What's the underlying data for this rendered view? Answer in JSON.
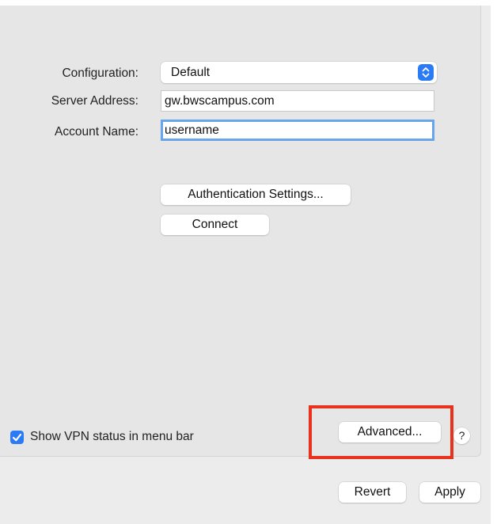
{
  "form": {
    "configuration_label": "Configuration:",
    "configuration_value": "Default",
    "server_address_label": "Server Address:",
    "server_address_value": "gw.bwscampus.com",
    "account_name_label": "Account Name:",
    "account_name_value": "username"
  },
  "buttons": {
    "authentication_settings": "Authentication Settings...",
    "connect": "Connect",
    "advanced": "Advanced...",
    "help": "?",
    "revert": "Revert",
    "apply": "Apply"
  },
  "options": {
    "show_vpn_status_label": "Show VPN status in menu bar",
    "show_vpn_status_checked": true
  },
  "colors": {
    "accent": "#2c7bf6",
    "focus_ring": "#6aa5ec",
    "highlight_box": "#e8321d",
    "panel_background": "#e6e6e6"
  },
  "icons": {
    "configuration_select": "chevron-up-down-icon",
    "checkbox": "checkmark-icon"
  }
}
